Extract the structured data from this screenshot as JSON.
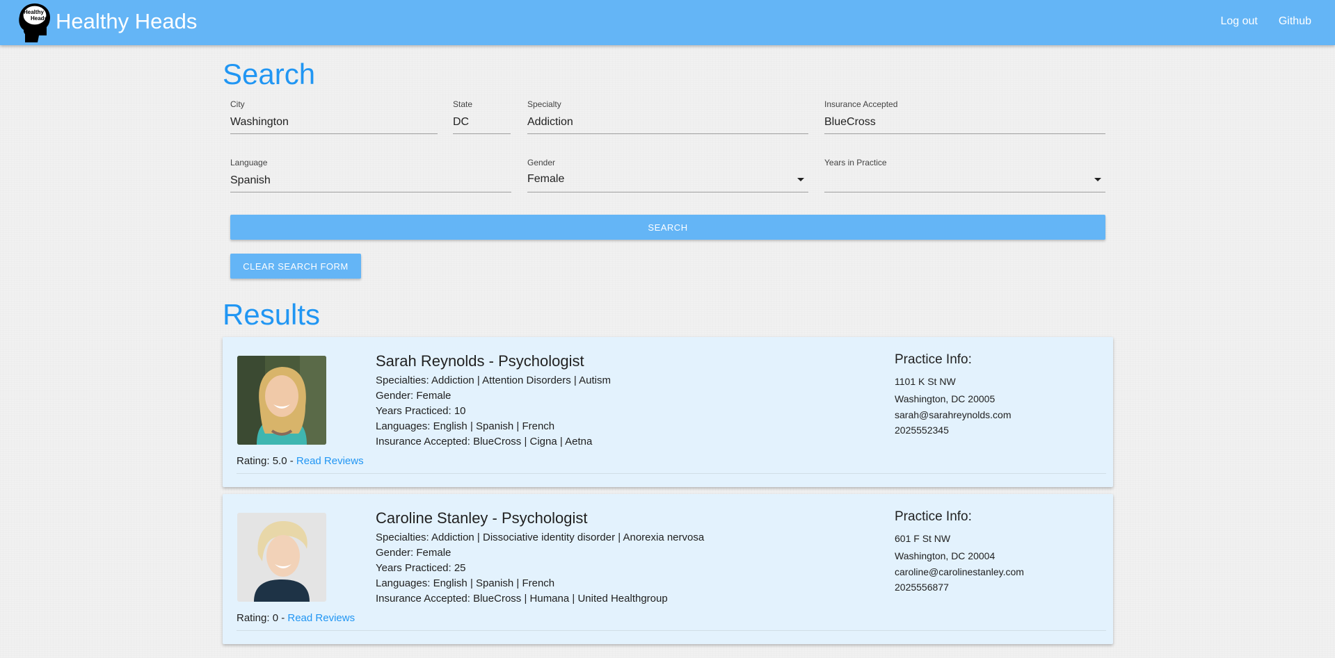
{
  "navbar": {
    "brand": "Healthy Heads",
    "logo_text_line1": "Healthy",
    "logo_text_line2": "Heads",
    "links": [
      "Log out",
      "Github"
    ]
  },
  "search": {
    "title": "Search",
    "fields": {
      "city": {
        "label": "City",
        "value": "Washington"
      },
      "state": {
        "label": "State",
        "value": "DC"
      },
      "specialty": {
        "label": "Specialty",
        "value": "Addiction"
      },
      "insurance": {
        "label": "Insurance Accepted",
        "value": "BlueCross"
      },
      "language": {
        "label": "Language",
        "value": "Spanish"
      },
      "gender": {
        "label": "Gender",
        "value": "Female"
      },
      "years": {
        "label": "Years in Practice",
        "value": ""
      }
    },
    "search_button": "SEARCH",
    "clear_button": "CLEAR SEARCH FORM"
  },
  "results": {
    "title": "Results",
    "items": [
      {
        "name": "Sarah Reynolds - Psychologist",
        "specialties": "Specialties: Addiction | Attention Disorders | Autism",
        "gender": "Gender: Female",
        "years": "Years Practiced: 10",
        "languages": "Languages: English | Spanish | French",
        "insurance": "Insurance Accepted: BlueCross | Cigna | Aetna",
        "rating": "Rating: 5.0 - ",
        "review_link": "Read Reviews",
        "practice_title": "Practice Info:",
        "address1": "1101 K St NW",
        "address2": "Washington, DC 20005",
        "email": "sarah@sarahreynolds.com",
        "phone": "2025552345"
      },
      {
        "name": "Caroline Stanley - Psychologist",
        "specialties": "Specialties: Addiction | Dissociative identity disorder | Anorexia nervosa",
        "gender": "Gender: Female",
        "years": "Years Practiced: 25",
        "languages": "Languages: English | Spanish | French",
        "insurance": "Insurance Accepted: BlueCross | Humana | United Healthgroup",
        "rating": "Rating: 0 - ",
        "review_link": "Read Reviews",
        "practice_title": "Practice Info:",
        "address1": "601 F St NW",
        "address2": "Washington, DC 20004",
        "email": "caroline@carolinestanley.com",
        "phone": "2025556877"
      }
    ]
  },
  "colors": {
    "navbar": "#64b5f6",
    "accent": "#2196f3",
    "card": "#e3f2fd"
  }
}
